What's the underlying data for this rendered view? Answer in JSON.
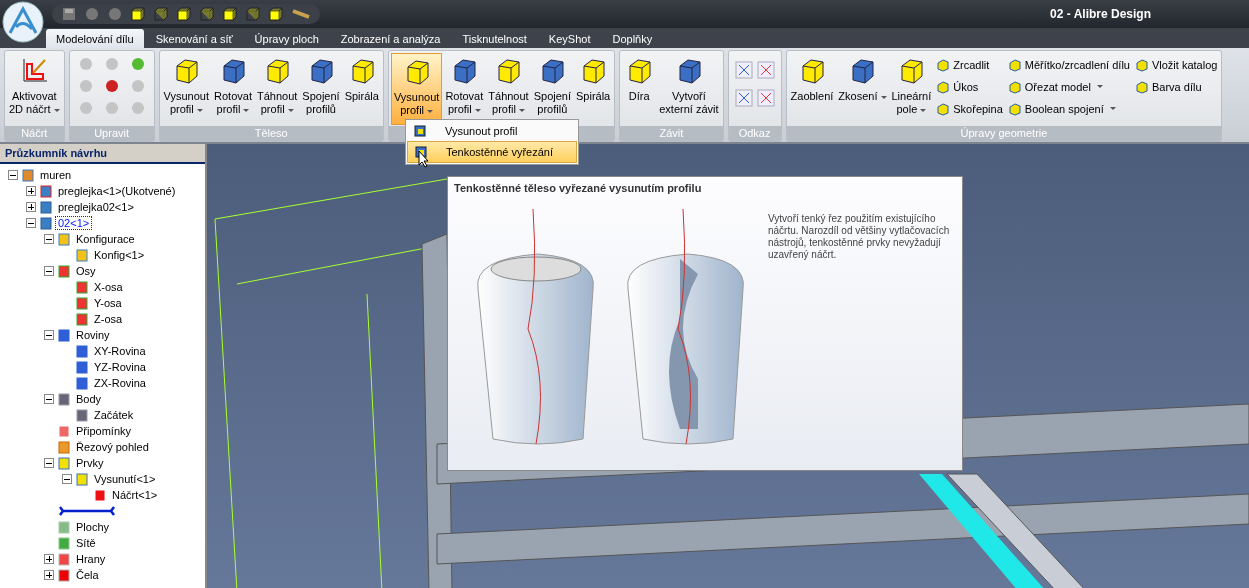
{
  "window": {
    "title": "02 - Alibre Design"
  },
  "tabs": [
    {
      "label": "Modelování dílu",
      "selected": true
    },
    {
      "label": "Skenování a síť",
      "selected": false
    },
    {
      "label": "Úpravy ploch",
      "selected": false
    },
    {
      "label": "Zobrazení a analýza",
      "selected": false
    },
    {
      "label": "Tisknutelnost",
      "selected": false
    },
    {
      "label": "KeyShot",
      "selected": false
    },
    {
      "label": "Doplňky",
      "selected": false
    }
  ],
  "ribbon": {
    "groups": [
      {
        "label": "Náčrt",
        "kind": "buttons",
        "items": [
          {
            "kind": "large",
            "label": "Aktivovat\n2D náčrt",
            "dropdown": true,
            "selected": false
          }
        ]
      },
      {
        "label": "Upravit",
        "kind": "icon_grid"
      },
      {
        "label": "Těleso",
        "kind": "buttons",
        "items": [
          {
            "kind": "large",
            "label": "Vysunout\nprofil",
            "dropdown": true,
            "selected": false
          },
          {
            "kind": "large",
            "label": "Rotovat\nprofil",
            "dropdown": true,
            "selected": false
          },
          {
            "kind": "large",
            "label": "Táhnout\nprofil",
            "dropdown": true,
            "selected": false
          },
          {
            "kind": "large",
            "label": "Spojení\nprofilů",
            "dropdown": false,
            "selected": false
          },
          {
            "kind": "large",
            "label": "Spirála",
            "dropdown": false,
            "selected": false
          }
        ]
      },
      {
        "kind": "buttons",
        "items": [
          {
            "kind": "large",
            "label": "Vysunout\nprofil",
            "dropdown": true,
            "selected": true
          },
          {
            "kind": "large",
            "label": "Rotovat\nprofil",
            "dropdown": true,
            "selected": false
          },
          {
            "kind": "large",
            "label": "Táhnout\nprofil",
            "dropdown": true,
            "selected": false
          },
          {
            "kind": "large",
            "label": "Spojení\nprofilů",
            "dropdown": false,
            "selected": false
          },
          {
            "kind": "large",
            "label": "Spirála",
            "dropdown": false,
            "selected": false
          }
        ]
      },
      {
        "label": "Závit",
        "kind": "buttons",
        "items": [
          {
            "kind": "large",
            "label": "Díra",
            "dropdown": false,
            "selected": false
          },
          {
            "kind": "large",
            "label": "Vytvoří\nexterní závit",
            "dropdown": false,
            "selected": false
          }
        ]
      },
      {
        "label": "Odkaz",
        "kind": "icon_pairs"
      },
      {
        "label": "Úpravy geometrie",
        "kind": "buttons",
        "items": [
          {
            "kind": "large",
            "label": "Zaoblení",
            "dropdown": false,
            "selected": false
          },
          {
            "kind": "large",
            "label": "Zkosení",
            "dropdown": true,
            "selected": false
          },
          {
            "kind": "large",
            "label": "Lineární\npole",
            "dropdown": true,
            "selected": false
          },
          {
            "kind": "column",
            "items": [
              {
                "label": "Zrcadlit",
                "dropdown": false
              },
              {
                "label": "Úkos",
                "dropdown": false
              },
              {
                "label": "Skořepina",
                "dropdown": false
              }
            ]
          },
          {
            "kind": "column",
            "items": [
              {
                "label": "Měřítko/zrcadlení dílu",
                "dropdown": false
              },
              {
                "label": "Ořezat model",
                "dropdown": true
              },
              {
                "label": "Boolean spojení",
                "dropdown": true
              }
            ]
          },
          {
            "kind": "column",
            "items": [
              {
                "label": "Vložit katalog",
                "dropdown": false
              },
              {
                "label": "Barva dílu",
                "dropdown": false
              }
            ]
          }
        ]
      }
    ]
  },
  "menu": {
    "items": [
      {
        "label": "Vysunout profil",
        "selected": false
      },
      {
        "label": "Tenkostěnné vyřezání",
        "selected": true
      }
    ]
  },
  "tooltip": {
    "title": "Tenkostěnné těleso vyřezané vysunutím profilu",
    "description": "Vytvoří tenký řez použitím existujícího náčrtu. Narozdíl od většiny vytlačovacích nástrojů, tenkostěnné prvky nevyžadují uzavřený náčrt."
  },
  "explorer": {
    "title": "Průzkumník návrhu",
    "tree": [
      {
        "label": "muren",
        "kind": "assembly",
        "expanded": true,
        "selected": false,
        "children": [
          {
            "label": "preglejka<1>(Ukotvené)",
            "kind": "anchored",
            "expanded": false,
            "selected": false
          },
          {
            "label": "preglejka02<1>",
            "kind": "part",
            "expanded": false,
            "selected": false
          },
          {
            "label": "02<1>",
            "kind": "part",
            "expanded": true,
            "selected": true,
            "children": [
              {
                "label": "Konfigurace",
                "kind": "config",
                "expanded": true,
                "selected": false,
                "children": [
                  {
                    "label": "Konfig<1>",
                    "kind": "config",
                    "selected": false
                  }
                ]
              },
              {
                "label": "Osy",
                "kind": "axis",
                "expanded": true,
                "selected": false,
                "children": [
                  {
                    "label": "X-osa",
                    "kind": "axis",
                    "selected": false
                  },
                  {
                    "label": "Y-osa",
                    "kind": "axis",
                    "selected": false
                  },
                  {
                    "label": "Z-osa",
                    "kind": "axis",
                    "selected": false
                  }
                ]
              },
              {
                "label": "Roviny",
                "kind": "plane",
                "expanded": true,
                "selected": false,
                "children": [
                  {
                    "label": "XY-Rovina",
                    "kind": "plane",
                    "selected": false
                  },
                  {
                    "label": "YZ-Rovina",
                    "kind": "plane",
                    "selected": false
                  },
                  {
                    "label": "ZX-Rovina",
                    "kind": "plane",
                    "selected": false
                  }
                ]
              },
              {
                "label": "Body",
                "kind": "point",
                "expanded": true,
                "selected": false,
                "children": [
                  {
                    "label": "Začátek",
                    "kind": "point",
                    "selected": false
                  }
                ]
              },
              {
                "label": "Připomínky",
                "kind": "notes",
                "selected": false
              },
              {
                "label": "Řezový pohled",
                "kind": "section",
                "selected": false
              },
              {
                "label": "Prvky",
                "kind": "features",
                "expanded": true,
                "selected": false,
                "children": [
                  {
                    "label": "Vysunutí<1>",
                    "kind": "extrude",
                    "expanded": true,
                    "selected": false,
                    "children": [
                      {
                        "label": "Náčrt<1>",
                        "kind": "sketch",
                        "selected": false
                      }
                    ]
                  }
                ]
              },
              {
                "kind": "rollback"
              },
              {
                "label": "Plochy",
                "kind": "surfaces",
                "selected": false
              },
              {
                "label": "Sítě",
                "kind": "meshes",
                "selected": false
              },
              {
                "label": "Hrany",
                "kind": "edges",
                "expanded": false,
                "selected": false
              },
              {
                "label": "Čela",
                "kind": "faces",
                "expanded": false,
                "selected": false
              }
            ]
          }
        ]
      }
    ]
  }
}
